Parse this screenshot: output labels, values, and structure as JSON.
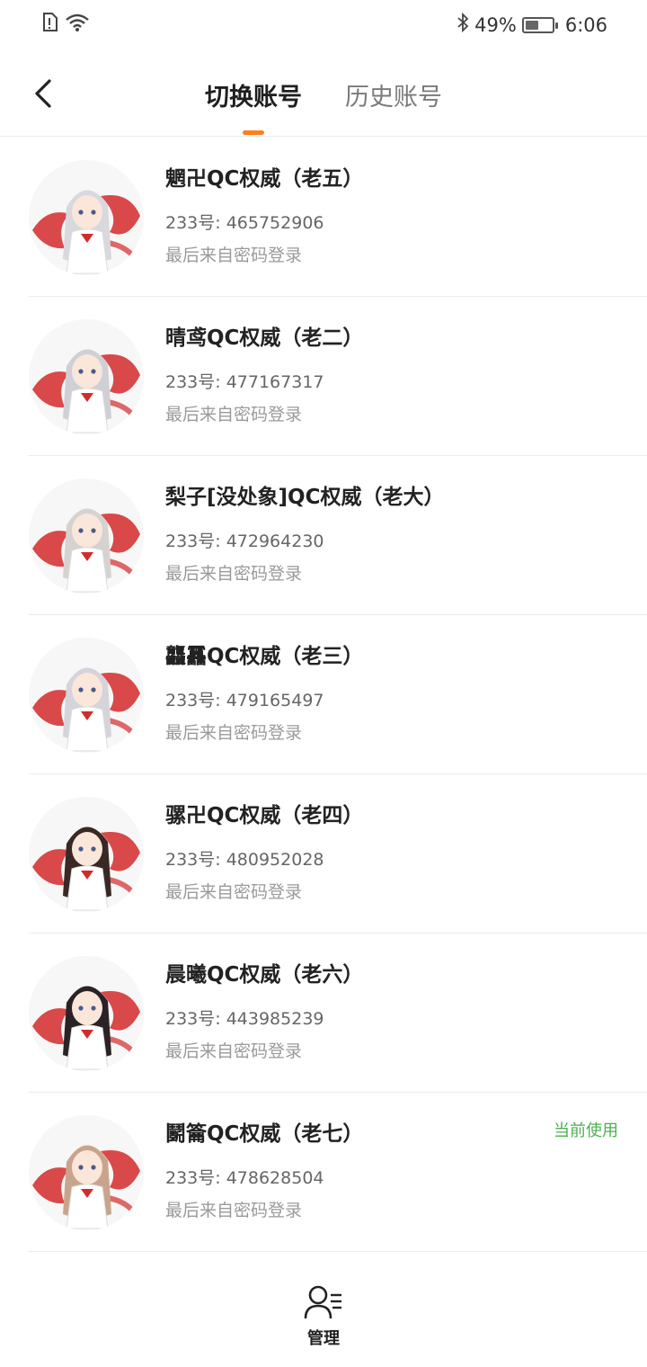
{
  "status_bar": {
    "battery_percent": "49%",
    "battery_level": 0.49,
    "time": "6:06"
  },
  "header": {
    "tabs": [
      {
        "label": "切换账号",
        "active": true
      },
      {
        "label": "历史账号",
        "active": false
      }
    ],
    "accent_color": "#ff7e1f"
  },
  "accounts": [
    {
      "name": "魍卍QC权威（老五）",
      "id": "233号: 465752906",
      "login": "最后来自密码登录",
      "current": ""
    },
    {
      "name": "晴鸢QC权威（老二）",
      "id": "233号: 477167317",
      "login": "最后来自密码登录",
      "current": ""
    },
    {
      "name": "梨子[没处象]QC权威（老大）",
      "id": "233号: 472964230",
      "login": "最后来自密码登录",
      "current": ""
    },
    {
      "name": "龘靐QC权威（老三）",
      "id": "233号: 479165497",
      "login": "最后来自密码登录",
      "current": ""
    },
    {
      "name": "骡卍QC权威（老四）",
      "id": "233号: 480952028",
      "login": "最后来自密码登录",
      "current": ""
    },
    {
      "name": "晨曦QC权威（老六）",
      "id": "233号: 443985239",
      "login": "最后来自密码登录",
      "current": ""
    },
    {
      "name": "鬭籥QC权威（老七）",
      "id": "233号: 478628504",
      "login": "最后来自密码登录",
      "current": "当前使用"
    }
  ],
  "manage": {
    "label": "管理"
  },
  "colors": {
    "current_badge": "#4caf50",
    "avatar_brush": "#d42a2a"
  }
}
